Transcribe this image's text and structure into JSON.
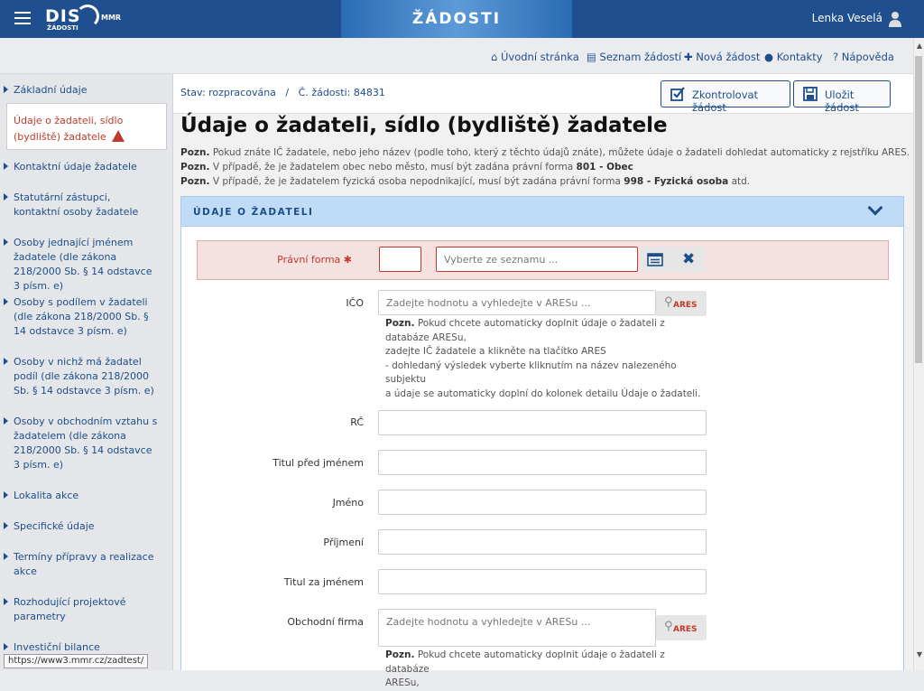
{
  "header": {
    "logo_text": "DIS",
    "logo_sub": "ŽÁDOSTI",
    "logo_mmr": "MMR",
    "title": "ŽÁDOSTI",
    "user_name": "Lenka Veselá"
  },
  "topnav": {
    "items": [
      "Úvodní stránka",
      "Seznam žádostí",
      "Nová žádost",
      "Kontakty",
      "Nápověda"
    ]
  },
  "sidebar": {
    "items": [
      "Základní údaje",
      "Údaje o žadateli, sídlo (bydliště) žadatele",
      "Kontaktní údaje žadatele",
      "Statutární zástupci, kontaktní osoby žadatele",
      "Osoby jednající jménem žadatele (dle zákona 218/2000 Sb. § 14 odstavce 3 písm. e)",
      "Osoby s podílem v žadateli (dle zákona 218/2000 Sb. § 14 odstavce 3 písm. e)",
      "Osoby v nichž má žadatel podíl (dle zákona 218/2000 Sb. § 14 odstavce 3 písm. e)",
      "Osoby v obchodním vztahu s žadatelem (dle zákona 218/2000 Sb. § 14 odstavce 3 písm. e)",
      "Lokalita akce",
      "Specifické údaje",
      "Termíny přípravy a realizace akce",
      "Rozhodující projektové parametry",
      "Investiční bilance"
    ]
  },
  "status_bar": {
    "status": "Stav: rozpracována",
    "separator": "/",
    "number": "Č. žádosti: 84831",
    "check_button": "Zkontrolovat žádost",
    "save_button": "Uložit žádost"
  },
  "page": {
    "title": "Údaje o žadateli, sídlo (bydliště) žadatele",
    "notes": [
      {
        "prefix": "Pozn.",
        "text": " Pokud znáte IČ žadatele, nebo jeho název (podle toho, který z těchto údajů znáte), můžete údaje o žadateli dohledat automaticky z rejstříku ARES.",
        "bold": "",
        "suffix": ""
      },
      {
        "prefix": "Pozn.",
        "text": " V případě, že je žadatelem obec nebo město, musí být zadána právní forma ",
        "bold": "801 - Obec",
        "suffix": ""
      },
      {
        "prefix": "Pozn.",
        "text": " V případě, že je žadatelem fyzická osoba nepodnikající, musí být zadána právní forma ",
        "bold": "998 - Fyzická osoba",
        "suffix": " atd."
      }
    ]
  },
  "panel": {
    "title": "ÚDAJE O ŽADATELI"
  },
  "form": {
    "pravni_forma": {
      "label": "Právní forma",
      "code_value": "",
      "select_placeholder": "Vyberte ze seznamu ..."
    },
    "ico": {
      "label": "IČO",
      "placeholder": "Zadejte hodnotu a vyhledejte v ARESu ...",
      "ares_label": "ARES"
    },
    "help": {
      "prefix": "Pozn.",
      "line1": " Pokud chcete automaticky doplnit údaje o žadateli z databáze ARESu,",
      "line2": "zadejte IČ žadatele a klikněte na tlačítko ARES",
      "line3": "- dohledaný výsledek vyberte kliknutím na název nalezeného subjektu",
      "line4": "a údaje se automaticky doplní do kolonek detailu Údaje o žadateli."
    },
    "rc": {
      "label": "RČ",
      "value": ""
    },
    "titul_pred": {
      "label": "Titul před jménem",
      "value": ""
    },
    "jmeno": {
      "label": "Jméno",
      "value": ""
    },
    "prijmeni": {
      "label": "Příjmení",
      "value": ""
    },
    "titul_za": {
      "label": "Titul za jménem",
      "value": ""
    },
    "obchodni_firma": {
      "label": "Obchodní firma",
      "placeholder": "Zadejte hodnotu a vyhledejte v ARESu ...",
      "ares_label": "ARES"
    },
    "help2": {
      "prefix": "Pozn.",
      "line1": " Pokud chcete automaticky doplnit údaje o žadateli z databáze",
      "line2": "ARESu,"
    }
  },
  "status_url": "https://www3.mmr.cz/zadtest/"
}
